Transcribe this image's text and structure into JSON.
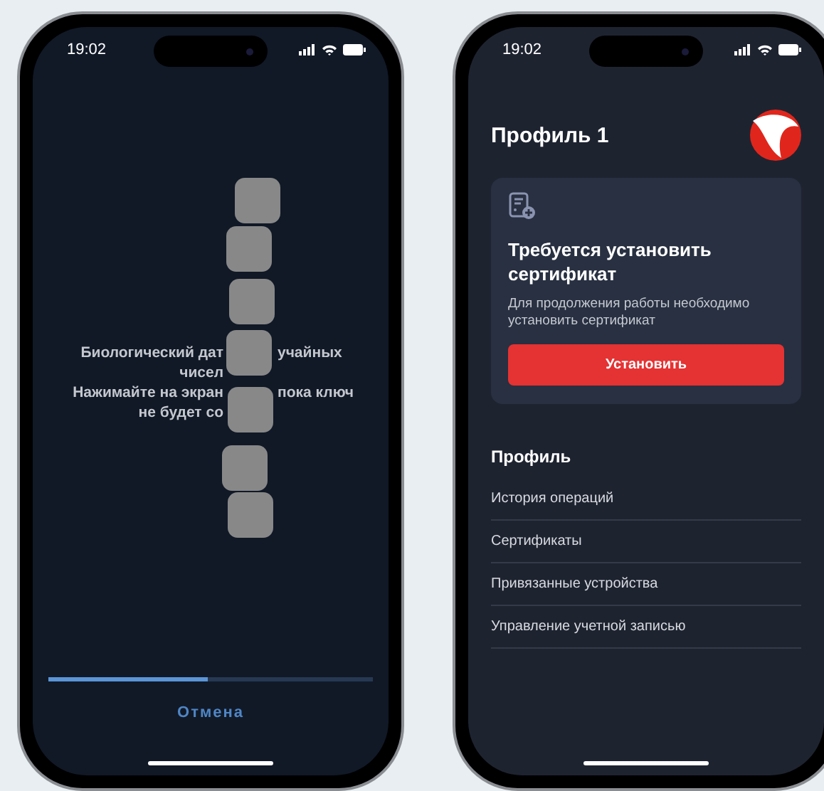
{
  "phones": [
    {
      "kind": "generator",
      "status_time": "19:02",
      "hint_lines": [
        [
          "Биологический дат",
          "учайных"
        ],
        [
          "чисел"
        ],
        [
          "Нажимайте на экран",
          "пока ключ"
        ],
        [
          "не будет со"
        ]
      ],
      "progress": {
        "level": 0.49
      },
      "cancel_button": "Отмена"
    },
    {
      "kind": "profile",
      "status_time": "19:02",
      "title": "Профиль 1",
      "notice": {
        "title": "Требуется установить сертификат",
        "text": "Для продолжения работы необходимо установить сертификат",
        "button": "Установить"
      },
      "section_title": "Профиль",
      "menu_items": [
        "История операций",
        "Сертификаты",
        "Привязанные устройства",
        "Управление учетной записью"
      ]
    }
  ]
}
